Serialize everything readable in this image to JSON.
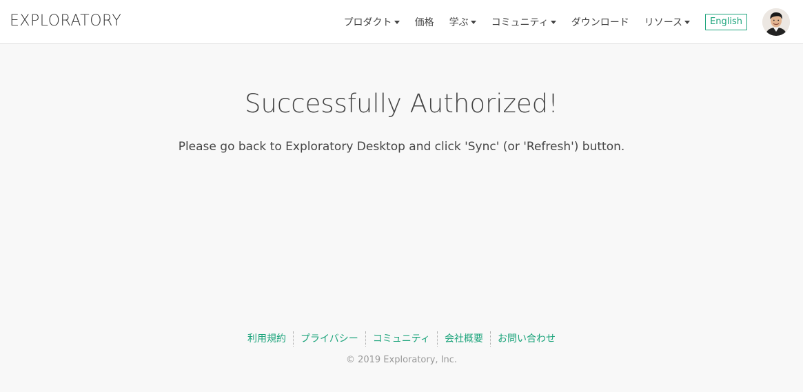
{
  "brand": {
    "logo_text": "EXPLORATORY"
  },
  "nav": {
    "items": [
      {
        "label": "プロダクト",
        "has_dropdown": true
      },
      {
        "label": "価格",
        "has_dropdown": false
      },
      {
        "label": "学ぶ",
        "has_dropdown": true
      },
      {
        "label": "コミュニティ",
        "has_dropdown": true
      },
      {
        "label": "ダウンロード",
        "has_dropdown": false
      },
      {
        "label": "リソース",
        "has_dropdown": true
      }
    ],
    "language_button": "English"
  },
  "main": {
    "title": "Successfully Authorized!",
    "message": "Please go back to Exploratory Desktop and click 'Sync' (or 'Refresh') button."
  },
  "footer": {
    "links": [
      "利用規約",
      "プライバシー",
      "コミュニティ",
      "会社概要",
      "お問い合わせ"
    ],
    "copyright": "© 2019 Exploratory, Inc."
  },
  "colors": {
    "accent": "#1aa37a",
    "background": "#f8f8f8",
    "text": "#444444"
  },
  "icons": {
    "dropdown": "caret-down-icon",
    "avatar": "user-avatar"
  }
}
